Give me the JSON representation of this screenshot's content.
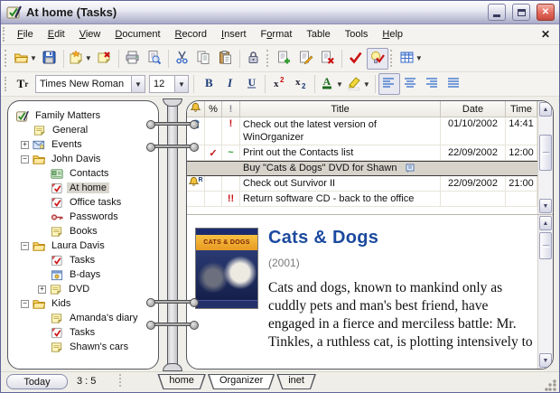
{
  "window": {
    "title": "At home (Tasks)"
  },
  "menu": {
    "items": [
      {
        "label": "File",
        "mnemonic": 0
      },
      {
        "label": "Edit",
        "mnemonic": 0
      },
      {
        "label": "View",
        "mnemonic": 0
      },
      {
        "label": "Document",
        "mnemonic": 0
      },
      {
        "label": "Record",
        "mnemonic": 0
      },
      {
        "label": "Insert",
        "mnemonic": 0
      },
      {
        "label": "Format",
        "mnemonic": 1
      },
      {
        "label": "Table",
        "mnemonic": -1
      },
      {
        "label": "Tools",
        "mnemonic": -1
      },
      {
        "label": "Help",
        "mnemonic": 0
      }
    ],
    "close_glyph": "✕"
  },
  "toolbar_main": {
    "groups": [
      {
        "grip": true,
        "buttons": [
          {
            "icon": "open-folder",
            "dropdown": true
          },
          {
            "icon": "save"
          }
        ]
      },
      {
        "buttons": [
          {
            "icon": "new-note",
            "dropdown": true
          },
          {
            "icon": "delete-note"
          }
        ]
      },
      {
        "buttons": [
          {
            "icon": "print"
          },
          {
            "icon": "print-preview"
          }
        ]
      },
      {
        "buttons": [
          {
            "icon": "cut"
          },
          {
            "icon": "copy"
          },
          {
            "icon": "paste"
          }
        ]
      },
      {
        "buttons": [
          {
            "icon": "lock"
          }
        ]
      },
      {
        "grip": true,
        "buttons": [
          {
            "icon": "add-record"
          },
          {
            "icon": "edit-record"
          },
          {
            "icon": "delete-record"
          }
        ]
      },
      {
        "buttons": [
          {
            "icon": "mark-completed"
          },
          {
            "icon": "show-completed",
            "pressed": true
          }
        ]
      },
      {
        "grip": true,
        "buttons": [
          {
            "icon": "table-view",
            "dropdown": true
          }
        ]
      }
    ]
  },
  "format_toolbar": {
    "font_name": "Times New Roman",
    "font_size": "12",
    "groups": [
      {
        "buttons": [
          {
            "icon": "bold"
          },
          {
            "icon": "italic"
          },
          {
            "icon": "underline"
          }
        ]
      },
      {
        "buttons": [
          {
            "icon": "superscript"
          },
          {
            "icon": "subscript"
          }
        ]
      },
      {
        "buttons": [
          {
            "icon": "font-color",
            "dropdown": true
          },
          {
            "icon": "highlight",
            "dropdown": true
          }
        ]
      },
      {
        "buttons": [
          {
            "icon": "align-left",
            "pressed": true
          },
          {
            "icon": "align-center"
          },
          {
            "icon": "align-right"
          },
          {
            "icon": "align-justify"
          }
        ]
      }
    ]
  },
  "sidebar": {
    "items": [
      {
        "label": "Family Matters",
        "level": 0,
        "icon": "organizer"
      },
      {
        "label": "General",
        "level": 1,
        "icon": "note"
      },
      {
        "label": "Events",
        "level": 1,
        "icon": "events",
        "expand": "plus"
      },
      {
        "label": "John Davis",
        "level": 1,
        "icon": "folder",
        "expand": "minus"
      },
      {
        "label": "Contacts",
        "level": 2,
        "icon": "contacts"
      },
      {
        "label": "At home",
        "level": 2,
        "icon": "task",
        "selected": true
      },
      {
        "label": "Office tasks",
        "level": 2,
        "icon": "task"
      },
      {
        "label": "Passwords",
        "level": 2,
        "icon": "key"
      },
      {
        "label": "Books",
        "level": 2,
        "icon": "note"
      },
      {
        "label": "Laura Davis",
        "level": 1,
        "icon": "folder",
        "expand": "minus"
      },
      {
        "label": "Tasks",
        "level": 2,
        "icon": "task"
      },
      {
        "label": "B-days",
        "level": 2,
        "icon": "bdays"
      },
      {
        "label": "DVD",
        "level": 2,
        "icon": "note",
        "expand": "plus"
      },
      {
        "label": "Kids",
        "level": 1,
        "icon": "folder",
        "expand": "minus"
      },
      {
        "label": "Amanda's diary",
        "level": 2,
        "icon": "note"
      },
      {
        "label": "Tasks",
        "level": 2,
        "icon": "task"
      },
      {
        "label": "Shawn's cars",
        "level": 2,
        "icon": "note"
      }
    ]
  },
  "table": {
    "headers": {
      "alarm_icon": "bell",
      "percent": "%",
      "priority": "!",
      "title": "Title",
      "date": "Date",
      "time": "Time"
    },
    "rows": [
      {
        "alarm": "recurrence",
        "priority": "exclaim",
        "title": "Check out the latest version of WinOrganizer",
        "date": "01/10/2002",
        "time": "14:41",
        "tall": true
      },
      {
        "percent": "check",
        "priority": "tilde",
        "title": "Print out the Contacts list",
        "date": "22/09/2002",
        "time": "12:00"
      },
      {
        "title": "Buy \"Cats & Dogs\" DVD for Shawn",
        "selected": true,
        "note": true
      },
      {
        "alarm": "bell-recurrence",
        "title": "Check out Survivor II",
        "date": "22/09/2002",
        "time": "21:00"
      },
      {
        "priority": "double-exclaim",
        "title": "Return software CD - back to the office"
      }
    ]
  },
  "detail": {
    "title": "Cats & Dogs",
    "year": "(2001)",
    "body": "Cats and dogs, known to mankind only as cuddly pets and man's best friend, have engaged in a fierce and merciless battle: Mr. Tinkles, a ruthless cat, is plotting intensively to",
    "poster_title": "CATS & DOGS"
  },
  "tabs": [
    {
      "label": "home"
    },
    {
      "label": "Organizer",
      "active": true
    },
    {
      "label": "inet"
    }
  ],
  "statusbar": {
    "today_label": "Today",
    "counter": "3 : 5"
  },
  "colors": {
    "accent_blue": "#1B4A9E",
    "selection_gray": "#D7D3CB",
    "titlebar_bottom": "#A8A9C5",
    "close_red": "#D4584E",
    "align_icon_blue": "#4C7FD0"
  }
}
